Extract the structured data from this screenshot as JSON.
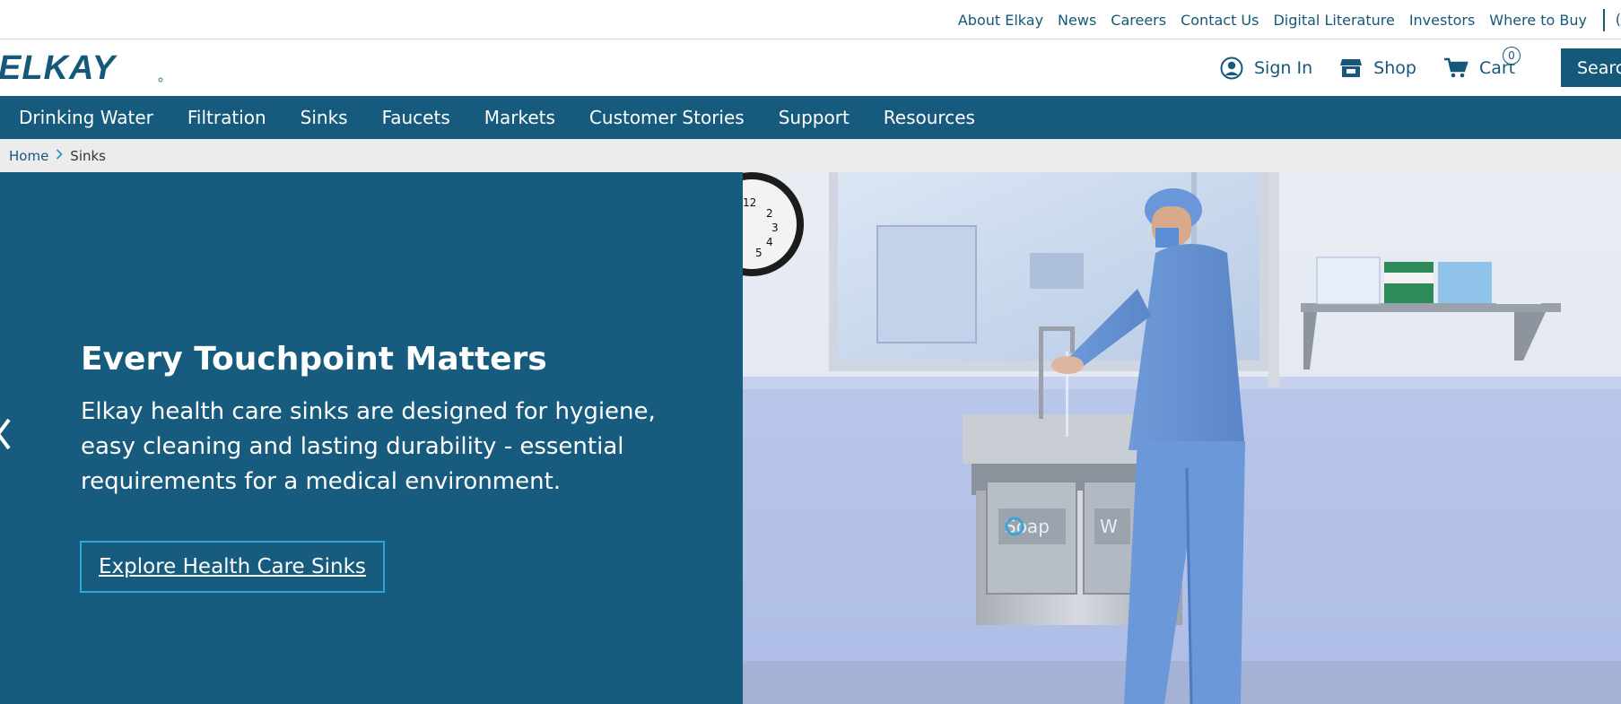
{
  "utility_nav": {
    "links": [
      "About Elkay",
      "News",
      "Careers",
      "Contact Us",
      "Digital Literature",
      "Investors",
      "Where to Buy"
    ],
    "overflow_glyph": "("
  },
  "header": {
    "logo_text": "ELKAY",
    "sign_in": "Sign In",
    "shop": "Shop",
    "cart": "Cart",
    "cart_count": "0",
    "search": "Search"
  },
  "main_nav": {
    "items": [
      "Drinking Water",
      "Filtration",
      "Sinks",
      "Faucets",
      "Markets",
      "Customer Stories",
      "Support",
      "Resources"
    ]
  },
  "breadcrumb": {
    "home": "Home",
    "current": "Sinks"
  },
  "hero": {
    "title": "Every Touchpoint Matters",
    "body": "Elkay health care sinks are designed for hygiene, easy cleaning and lasting durability - essential requirements for a medical environment.",
    "cta": "Explore Health Care Sinks",
    "image_sign_text": "Soap",
    "image_sign_text_2": "W"
  },
  "colors": {
    "brand_blue": "#165b7e",
    "link_blue": "#15587a",
    "cta_border": "#2aa8d8",
    "breadcrumb_bg": "#ececec"
  },
  "icons": {
    "sign_in": "user-circle-icon",
    "shop": "store-icon",
    "cart": "cart-icon",
    "carousel_prev": "chevron-left-icon"
  }
}
